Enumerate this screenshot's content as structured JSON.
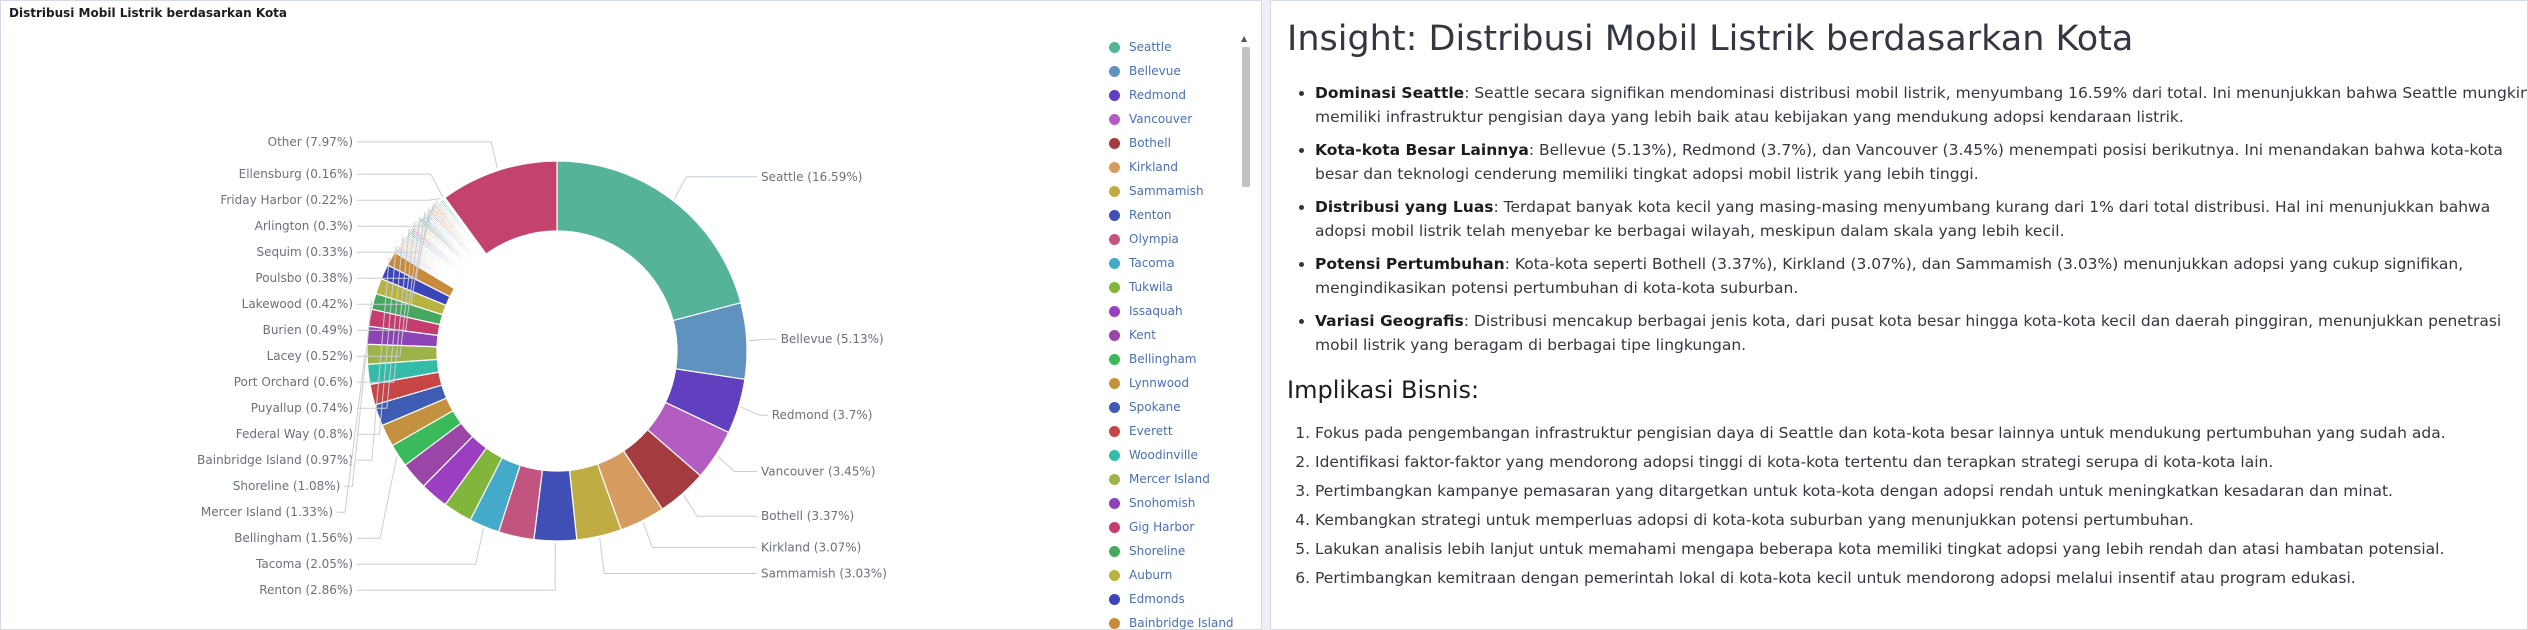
{
  "chart_panel": {
    "title": "Distribusi Mobil Listrik berdasarkan Kota"
  },
  "chart_data": {
    "type": "pie",
    "donut": true,
    "title": "Distribusi Mobil Listrik berdasarkan Kota",
    "legend_position": "right",
    "slices": [
      {
        "name": "Seattle",
        "label": "Seattle (16.59%)",
        "value": 16.59,
        "color": "#54b399"
      },
      {
        "name": "Bellevue",
        "label": "Bellevue (5.13%)",
        "value": 5.13,
        "color": "#6092c0"
      },
      {
        "name": "Redmond",
        "label": "Redmond (3.7%)",
        "value": 3.7,
        "color": "#6040bf"
      },
      {
        "name": "Vancouver",
        "label": "Vancouver (3.45%)",
        "value": 3.45,
        "color": "#b35dc2"
      },
      {
        "name": "Bothell",
        "label": "Bothell (3.37%)",
        "value": 3.37,
        "color": "#a33b3f"
      },
      {
        "name": "Kirkland",
        "label": "Kirkland (3.07%)",
        "value": 3.07,
        "color": "#d69c5f"
      },
      {
        "name": "Sammamish",
        "label": "Sammamish (3.03%)",
        "value": 3.03,
        "color": "#bfac42"
      },
      {
        "name": "Renton",
        "label": "Renton (2.86%)",
        "value": 2.86,
        "color": "#3f4fb5"
      },
      {
        "name": "Olympia",
        "label": "",
        "value": 2.4,
        "color": "#c25480"
      },
      {
        "name": "Tacoma",
        "label": "Tacoma (2.05%)",
        "value": 2.05,
        "color": "#44aac9"
      },
      {
        "name": "Tukwila",
        "label": "",
        "value": 1.95,
        "color": "#81b53b"
      },
      {
        "name": "Issaquah",
        "label": "",
        "value": 1.9,
        "color": "#9a3fbf"
      },
      {
        "name": "Kent",
        "label": "",
        "value": 1.85,
        "color": "#9a45a8"
      },
      {
        "name": "Bellingham",
        "label": "Bellingham (1.56%)",
        "value": 1.56,
        "color": "#3aba5a"
      },
      {
        "name": "Lynnwood",
        "label": "",
        "value": 1.5,
        "color": "#c4913f"
      },
      {
        "name": "Spokane",
        "label": "",
        "value": 1.45,
        "color": "#3f5cb5"
      },
      {
        "name": "Everett",
        "label": "",
        "value": 1.4,
        "color": "#c74545"
      },
      {
        "name": "Woodinville",
        "label": "",
        "value": 1.35,
        "color": "#35bca8"
      },
      {
        "name": "Mercer Island",
        "label": "Mercer Island (1.33%)",
        "value": 1.33,
        "color": "#9cb34a"
      },
      {
        "name": "Snohomish",
        "label": "",
        "value": 1.2,
        "color": "#8d43b5"
      },
      {
        "name": "Gig Harbor",
        "label": "",
        "value": 1.15,
        "color": "#c53d6e"
      },
      {
        "name": "Shoreline",
        "label": "Shoreline (1.08%)",
        "value": 1.08,
        "color": "#46a85f"
      },
      {
        "name": "Auburn",
        "label": "",
        "value": 1.05,
        "color": "#b7b342"
      },
      {
        "name": "Edmonds",
        "label": "",
        "value": 1.0,
        "color": "#3b44b8"
      },
      {
        "name": "Bainbridge Island",
        "label": "Bainbridge Island (0.97%)",
        "value": 0.97,
        "color": "#c98a3e"
      },
      {
        "name": "Federal Way",
        "label": "Federal Way (0.8%)",
        "value": 0.8,
        "color": "",
        "tail": true
      },
      {
        "name": "Puyallup",
        "label": "Puyallup (0.74%)",
        "value": 0.74,
        "color": "",
        "tail": true
      },
      {
        "name": "Port Orchard",
        "label": "Port Orchard (0.6%)",
        "value": 0.6,
        "color": "",
        "tail": true
      },
      {
        "name": "Lacey",
        "label": "Lacey (0.52%)",
        "value": 0.52,
        "color": "",
        "tail": true
      },
      {
        "name": "Burien",
        "label": "Burien (0.49%)",
        "value": 0.49,
        "color": "",
        "tail": true
      },
      {
        "name": "Lakewood",
        "label": "Lakewood (0.42%)",
        "value": 0.42,
        "color": "",
        "tail": true
      },
      {
        "name": "Poulsbo",
        "label": "Poulsbo (0.38%)",
        "value": 0.38,
        "color": "",
        "tail": true
      },
      {
        "name": "Sequim",
        "label": "Sequim (0.33%)",
        "value": 0.33,
        "color": "",
        "tail": true
      },
      {
        "name": "Arlington",
        "label": "Arlington (0.3%)",
        "value": 0.3,
        "color": "",
        "tail": true
      },
      {
        "name": "Friday Harbor",
        "label": "Friday Harbor (0.22%)",
        "value": 0.22,
        "color": "",
        "tail": true
      },
      {
        "name": "Ellensburg",
        "label": "Ellensburg (0.16%)",
        "value": 0.16,
        "color": "",
        "tail": true
      },
      {
        "name": "Other",
        "label": "Other (7.97%)",
        "value": 7.97,
        "color": "#c4436d"
      }
    ],
    "tail_colors": [
      "#54b399",
      "#6092c0",
      "#d36086",
      "#9170b8",
      "#ca8eae",
      "#d6bf57",
      "#b9a888",
      "#da8b45",
      "#aa6556",
      "#e7664c",
      "#3aba5a",
      "#3f4fb5",
      "#c4913f",
      "#35bca8"
    ]
  },
  "legend": {
    "items": [
      {
        "name": "Seattle",
        "color": "#54b399"
      },
      {
        "name": "Bellevue",
        "color": "#6092c0"
      },
      {
        "name": "Redmond",
        "color": "#6040bf"
      },
      {
        "name": "Vancouver",
        "color": "#b35dc2"
      },
      {
        "name": "Bothell",
        "color": "#a33b3f"
      },
      {
        "name": "Kirkland",
        "color": "#d69c5f"
      },
      {
        "name": "Sammamish",
        "color": "#bfac42"
      },
      {
        "name": "Renton",
        "color": "#3f4fb5"
      },
      {
        "name": "Olympia",
        "color": "#c25480"
      },
      {
        "name": "Tacoma",
        "color": "#44aac9"
      },
      {
        "name": "Tukwila",
        "color": "#81b53b"
      },
      {
        "name": "Issaquah",
        "color": "#9a3fbf"
      },
      {
        "name": "Kent",
        "color": "#9a45a8"
      },
      {
        "name": "Bellingham",
        "color": "#3aba5a"
      },
      {
        "name": "Lynnwood",
        "color": "#c4913f"
      },
      {
        "name": "Spokane",
        "color": "#3f5cb5"
      },
      {
        "name": "Everett",
        "color": "#c74545"
      },
      {
        "name": "Woodinville",
        "color": "#35bca8"
      },
      {
        "name": "Mercer Island",
        "color": "#9cb34a"
      },
      {
        "name": "Snohomish",
        "color": "#8d43b5"
      },
      {
        "name": "Gig Harbor",
        "color": "#c53d6e"
      },
      {
        "name": "Shoreline",
        "color": "#46a85f"
      },
      {
        "name": "Auburn",
        "color": "#b7b342"
      },
      {
        "name": "Edmonds",
        "color": "#3b44b8"
      },
      {
        "name": "Bainbridge Island",
        "color": "#c98a3e"
      }
    ]
  },
  "insight": {
    "title": "Insight: Distribusi Mobil Listrik berdasarkan Kota",
    "points": [
      {
        "bold": "Dominasi Seattle",
        "text": ": Seattle secara signifikan mendominasi distribusi mobil listrik, menyumbang 16.59% dari total. Ini menunjukkan bahwa Seattle mungkin memiliki infrastruktur pengisian daya yang lebih baik atau kebijakan yang mendukung adopsi kendaraan listrik."
      },
      {
        "bold": "Kota-kota Besar Lainnya",
        "text": ": Bellevue (5.13%), Redmond (3.7%), dan Vancouver (3.45%) menempati posisi berikutnya. Ini menandakan bahwa kota-kota besar dan teknologi cenderung memiliki tingkat adopsi mobil listrik yang lebih tinggi."
      },
      {
        "bold": "Distribusi yang Luas",
        "text": ": Terdapat banyak kota kecil yang masing-masing menyumbang kurang dari 1% dari total distribusi. Hal ini menunjukkan bahwa adopsi mobil listrik telah menyebar ke berbagai wilayah, meskipun dalam skala yang lebih kecil."
      },
      {
        "bold": "Potensi Pertumbuhan",
        "text": ": Kota-kota seperti Bothell (3.37%), Kirkland (3.07%), dan Sammamish (3.03%) menunjukkan adopsi yang cukup signifikan, mengindikasikan potensi pertumbuhan di kota-kota suburban."
      },
      {
        "bold": "Variasi Geografis",
        "text": ": Distribusi mencakup berbagai jenis kota, dari pusat kota besar hingga kota-kota kecil dan daerah pinggiran, menunjukkan penetrasi mobil listrik yang beragam di berbagai tipe lingkungan."
      }
    ],
    "implications_title": "Implikasi Bisnis:",
    "implications": [
      "Fokus pada pengembangan infrastruktur pengisian daya di Seattle dan kota-kota besar lainnya untuk mendukung pertumbuhan yang sudah ada.",
      "Identifikasi faktor-faktor yang mendorong adopsi tinggi di kota-kota tertentu dan terapkan strategi serupa di kota-kota lain.",
      "Pertimbangkan kampanye pemasaran yang ditargetkan untuk kota-kota dengan adopsi rendah untuk meningkatkan kesadaran dan minat.",
      "Kembangkan strategi untuk memperluas adopsi di kota-kota suburban yang menunjukkan potensi pertumbuhan.",
      "Lakukan analisis lebih lanjut untuk memahami mengapa beberapa kota memiliki tingkat adopsi yang lebih rendah dan atasi hambatan potensial.",
      "Pertimbangkan kemitraan dengan pemerintah lokal di kota-kota kecil untuk mendorong adopsi melalui insentif atau program edukasi."
    ]
  }
}
